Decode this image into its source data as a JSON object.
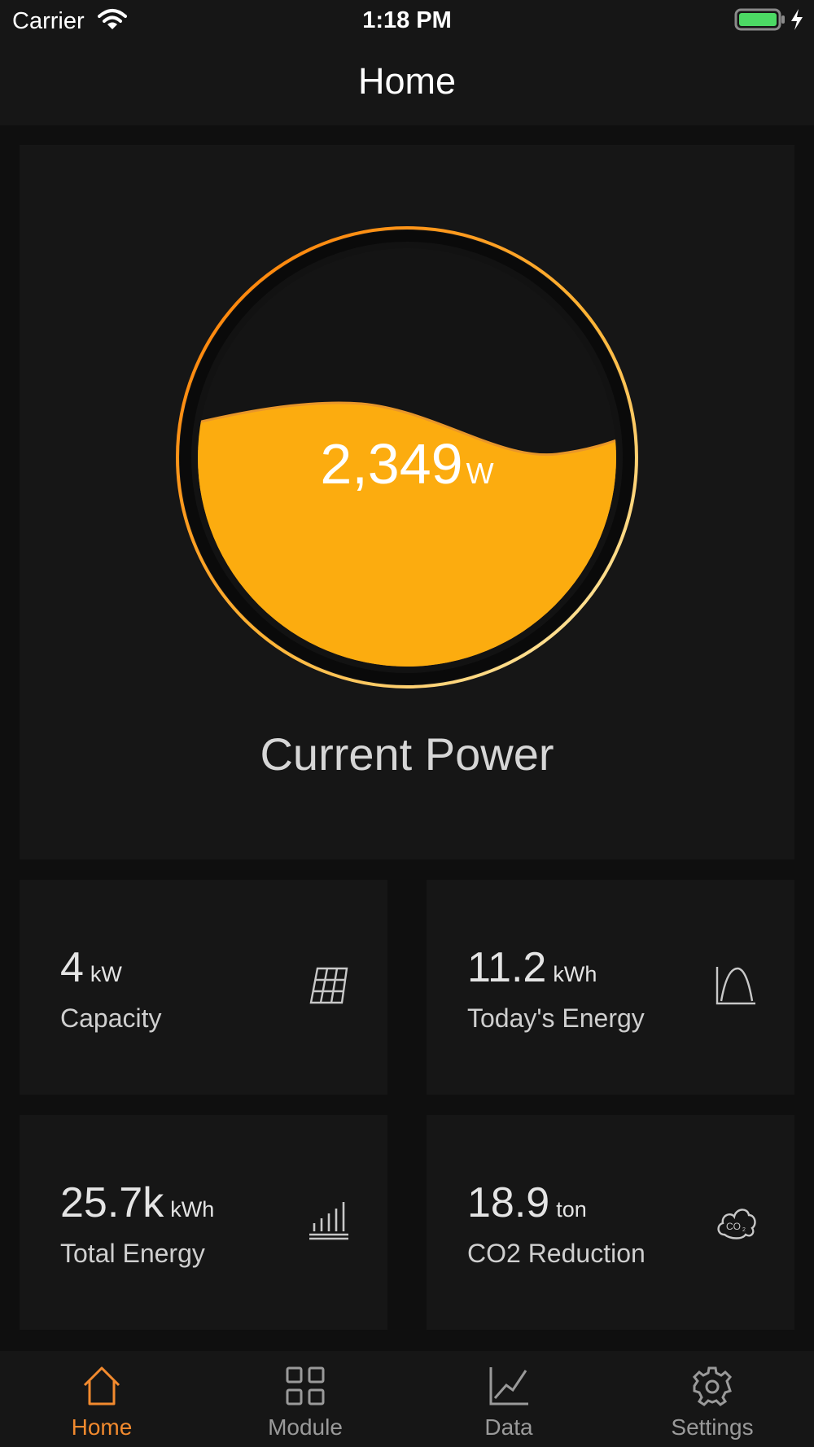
{
  "status_bar": {
    "carrier": "Carrier",
    "time": "1:18 PM"
  },
  "nav": {
    "title": "Home"
  },
  "power": {
    "value": "2,349",
    "unit": "W",
    "label": "Current Power"
  },
  "stats": [
    {
      "value": "4",
      "unit": "kW",
      "label": "Capacity",
      "icon": "solar-panel-icon"
    },
    {
      "value": "11.2",
      "unit": "kWh",
      "label": "Today's Energy",
      "icon": "curve-chart-icon"
    },
    {
      "value": "25.7k",
      "unit": "kWh",
      "label": "Total Energy",
      "icon": "bar-chart-icon"
    },
    {
      "value": "18.9",
      "unit": "ton",
      "label": "CO2 Reduction",
      "icon": "co2-cloud-icon"
    }
  ],
  "tabs": [
    {
      "label": "Home",
      "icon": "home-icon",
      "active": true
    },
    {
      "label": "Module",
      "icon": "grid-icon",
      "active": false
    },
    {
      "label": "Data",
      "icon": "line-chart-icon",
      "active": false
    },
    {
      "label": "Settings",
      "icon": "gear-icon",
      "active": false
    }
  ],
  "colors": {
    "accent": "#f28a2e",
    "fill": "#fcac0f",
    "wave_back": "#d07a2a",
    "card": "#161616",
    "background": "#0f0f0f"
  }
}
